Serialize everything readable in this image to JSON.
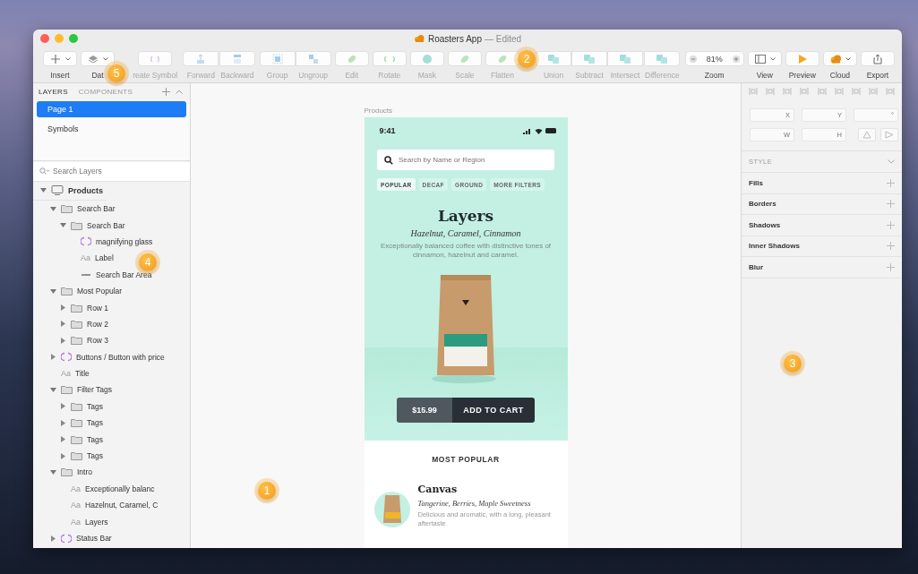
{
  "window": {
    "title": "Roasters App",
    "status": "— Edited"
  },
  "toolbar": [
    {
      "items": [
        {
          "label": "Insert",
          "kind": "icon",
          "dropdown": true,
          "disabled": false
        }
      ]
    },
    {
      "items": [
        {
          "label": "Dat",
          "kind": "icon",
          "dropdown": true,
          "disabled": false
        }
      ]
    },
    {
      "items": [
        {
          "label": "reate Symbol",
          "kind": "icon",
          "disabled": true
        }
      ]
    },
    {
      "items": [
        {
          "label": "Forward",
          "kind": "icon",
          "disabled": true
        },
        {
          "label": "Backward",
          "kind": "icon",
          "disabled": true
        }
      ]
    },
    {
      "items": [
        {
          "label": "Group",
          "kind": "icon",
          "disabled": true
        },
        {
          "label": "Ungroup",
          "kind": "icon",
          "disabled": true
        }
      ]
    },
    {
      "items": [
        {
          "label": "Edit",
          "kind": "icon",
          "disabled": true
        }
      ]
    },
    {
      "items": [
        {
          "label": "Rotate",
          "kind": "icon",
          "disabled": true
        }
      ]
    },
    {
      "items": [
        {
          "label": "Mask",
          "kind": "icon",
          "disabled": true
        }
      ]
    },
    {
      "items": [
        {
          "label": "Scale",
          "kind": "icon",
          "disabled": true
        }
      ]
    },
    {
      "items": [
        {
          "label": "Flatten",
          "kind": "icon",
          "disabled": true
        }
      ]
    },
    {
      "items": [
        {
          "label": "Union",
          "kind": "icon",
          "disabled": true
        },
        {
          "label": "Subtract",
          "kind": "icon",
          "disabled": true
        },
        {
          "label": "Intersect",
          "kind": "icon",
          "disabled": true
        },
        {
          "label": "Difference",
          "kind": "icon",
          "disabled": true
        }
      ]
    },
    {
      "items": [
        {
          "label": "Zoom",
          "kind": "zoom",
          "value": "81%",
          "disabled": false
        }
      ]
    },
    {
      "items": [
        {
          "label": "View",
          "kind": "icon",
          "dropdown": true,
          "disabled": false
        }
      ]
    },
    {
      "items": [
        {
          "label": "Preview",
          "kind": "icon",
          "disabled": false
        }
      ]
    },
    {
      "items": [
        {
          "label": "Cloud",
          "kind": "icon",
          "dropdown": true,
          "disabled": false
        }
      ]
    },
    {
      "items": [
        {
          "label": "Export",
          "kind": "icon",
          "disabled": false
        }
      ]
    }
  ],
  "layers_panel": {
    "tabs": [
      {
        "label": "LAYERS",
        "selected": true
      },
      {
        "label": "COMPONENTS",
        "selected": false
      }
    ],
    "pages": [
      {
        "label": "Page 1",
        "selected": true
      },
      {
        "label": "Symbols",
        "selected": false
      }
    ],
    "search": {
      "placeholder": "Search Layers"
    },
    "tree": [
      {
        "label": "Products",
        "kind": "artboard",
        "expanded": true,
        "children": [
          {
            "label": "Search Bar",
            "kind": "group",
            "expanded": true,
            "children": [
              {
                "label": "Search Bar",
                "kind": "group",
                "expanded": true,
                "children": [
                  {
                    "label": "magnifying glass",
                    "kind": "symbol"
                  },
                  {
                    "label": "Label",
                    "kind": "text",
                    "glyph": "Aa"
                  },
                  {
                    "label": "Search Bar Area",
                    "kind": "shape"
                  }
                ]
              }
            ]
          },
          {
            "label": "Most Popular",
            "kind": "group",
            "expanded": true,
            "children": [
              {
                "label": "Row 1",
                "kind": "group",
                "expanded": false
              },
              {
                "label": "Row 2",
                "kind": "group",
                "expanded": false
              },
              {
                "label": "Row 3",
                "kind": "group",
                "expanded": false
              }
            ]
          },
          {
            "label": "Buttons / Button with price",
            "kind": "symbol",
            "expanded": false
          },
          {
            "label": "Title",
            "kind": "text",
            "glyph": "Aa"
          },
          {
            "label": "Filter Tags",
            "kind": "group",
            "expanded": true,
            "children": [
              {
                "label": "Tags",
                "kind": "group",
                "expanded": false
              },
              {
                "label": "Tags",
                "kind": "group",
                "expanded": false
              },
              {
                "label": "Tags",
                "kind": "group",
                "expanded": false
              },
              {
                "label": "Tags",
                "kind": "group",
                "expanded": false
              }
            ]
          },
          {
            "label": "Intro",
            "kind": "group",
            "expanded": true,
            "children": [
              {
                "label": "Exceptionally balanc",
                "kind": "text",
                "glyph": "Aa"
              },
              {
                "label": "Hazelnut, Caramel, C",
                "kind": "text",
                "glyph": "Aa"
              },
              {
                "label": "Layers",
                "kind": "text",
                "glyph": "Aa"
              }
            ]
          },
          {
            "label": "Status Bar",
            "kind": "symbol",
            "expanded": false
          }
        ]
      }
    ]
  },
  "canvas": {
    "artboard_name": "Products",
    "phone": {
      "time": "9:41",
      "search_placeholder": "Search by Name or Region",
      "tags": [
        {
          "label": "POPULAR",
          "selected": true
        },
        {
          "label": "DECAF",
          "selected": false
        },
        {
          "label": "GROUND",
          "selected": false
        },
        {
          "label": "MORE FILTERS",
          "selected": false
        }
      ],
      "heading": "Layers",
      "notes": "Hazelnut, Caramel, Cinnamon",
      "description": "Exceptionally balanced coffee with distinctive tones of cinnamon, hazelnut and caramel.",
      "price": "$15.99",
      "action": "ADD TO CART",
      "section_title": "MOST POPULAR",
      "items": [
        {
          "name": "Canvas",
          "notes": "Tangerine, Berries, Maple Sweetness",
          "description": "Delicious and aromatic, with a long, pleasant aftertaste."
        }
      ]
    }
  },
  "inspector": {
    "fields": [
      {
        "placeholder": "X"
      },
      {
        "placeholder": "Y"
      },
      {
        "placeholder": "°"
      },
      {
        "placeholder": "W"
      },
      {
        "placeholder": "H"
      }
    ],
    "style_title": "STYLE",
    "sections": [
      "Fills",
      "Borders",
      "Shadows",
      "Inner Shadows",
      "Blur"
    ]
  },
  "annotations": [
    {
      "number": "2"
    },
    {
      "number": "5"
    },
    {
      "number": "4"
    },
    {
      "number": "3"
    },
    {
      "number": "1"
    }
  ]
}
